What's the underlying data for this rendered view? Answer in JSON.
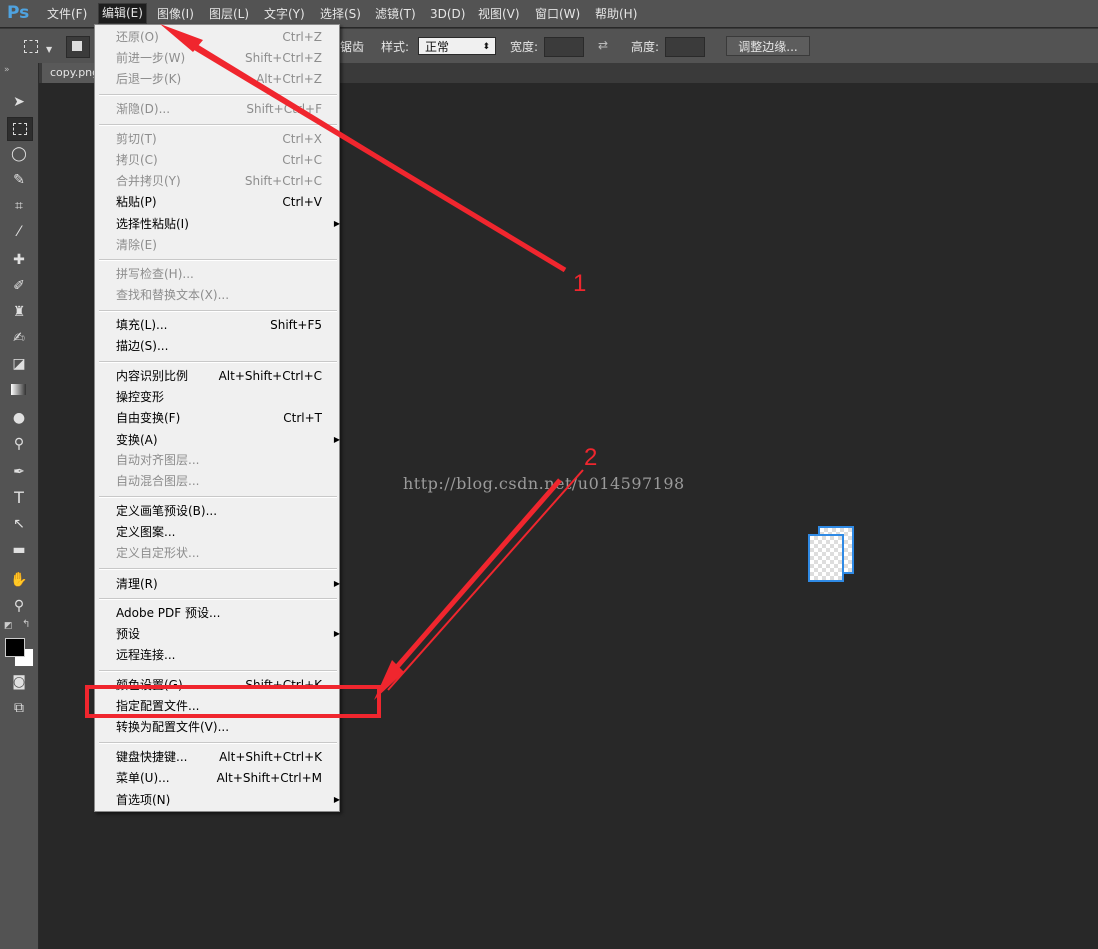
{
  "app_logo": "Ps",
  "menubar": [
    {
      "label": "文件(F)"
    },
    {
      "label": "编辑(E)",
      "active": true
    },
    {
      "label": "图像(I)"
    },
    {
      "label": "图层(L)"
    },
    {
      "label": "文字(Y)"
    },
    {
      "label": "选择(S)"
    },
    {
      "label": "滤镜(T)"
    },
    {
      "label": "3D(D)"
    },
    {
      "label": "视图(V)"
    },
    {
      "label": "窗口(W)"
    },
    {
      "label": "帮助(H)"
    }
  ],
  "options": {
    "partial_label": "锯齿",
    "style_label": "样式:",
    "style_value": "正常",
    "width_label": "宽度:",
    "height_label": "高度:",
    "refine_button": "调整边缘..."
  },
  "document_tab": "copy.png",
  "watermark": "http://blog.csdn.net/u014597198",
  "edit_menu": [
    {
      "label": "还原(O)",
      "shortcut": "Ctrl+Z",
      "disabled": true
    },
    {
      "label": "前进一步(W)",
      "shortcut": "Shift+Ctrl+Z",
      "disabled": true
    },
    {
      "label": "后退一步(K)",
      "shortcut": "Alt+Ctrl+Z",
      "disabled": true
    },
    {
      "sep": true
    },
    {
      "label": "渐隐(D)...",
      "shortcut": "Shift+Ctrl+F",
      "disabled": true
    },
    {
      "sep": true
    },
    {
      "label": "剪切(T)",
      "shortcut": "Ctrl+X",
      "disabled": true
    },
    {
      "label": "拷贝(C)",
      "shortcut": "Ctrl+C",
      "disabled": true
    },
    {
      "label": "合并拷贝(Y)",
      "shortcut": "Shift+Ctrl+C",
      "disabled": true
    },
    {
      "label": "粘贴(P)",
      "shortcut": "Ctrl+V",
      "disabled": false
    },
    {
      "label": "选择性粘贴(I)",
      "shortcut": "",
      "disabled": false,
      "submenu": true
    },
    {
      "label": "清除(E)",
      "shortcut": "",
      "disabled": true
    },
    {
      "sep": true
    },
    {
      "label": "拼写检查(H)...",
      "shortcut": "",
      "disabled": true
    },
    {
      "label": "查找和替换文本(X)...",
      "shortcut": "",
      "disabled": true
    },
    {
      "sep": true
    },
    {
      "label": "填充(L)...",
      "shortcut": "Shift+F5",
      "disabled": false
    },
    {
      "label": "描边(S)...",
      "shortcut": "",
      "disabled": false
    },
    {
      "sep": true
    },
    {
      "label": "内容识别比例",
      "shortcut": "Alt+Shift+Ctrl+C",
      "disabled": false
    },
    {
      "label": "操控变形",
      "shortcut": "",
      "disabled": false
    },
    {
      "label": "自由变换(F)",
      "shortcut": "Ctrl+T",
      "disabled": false
    },
    {
      "label": "变换(A)",
      "shortcut": "",
      "disabled": false,
      "submenu": true
    },
    {
      "label": "自动对齐图层...",
      "shortcut": "",
      "disabled": true
    },
    {
      "label": "自动混合图层...",
      "shortcut": "",
      "disabled": true
    },
    {
      "sep": true
    },
    {
      "label": "定义画笔预设(B)...",
      "shortcut": "",
      "disabled": false
    },
    {
      "label": "定义图案...",
      "shortcut": "",
      "disabled": false
    },
    {
      "label": "定义自定形状...",
      "shortcut": "",
      "disabled": true
    },
    {
      "sep": true
    },
    {
      "label": "清理(R)",
      "shortcut": "",
      "disabled": false,
      "submenu": true
    },
    {
      "sep": true
    },
    {
      "label": "Adobe PDF 预设...",
      "shortcut": "",
      "disabled": false
    },
    {
      "label": "预设",
      "shortcut": "",
      "disabled": false,
      "submenu": true
    },
    {
      "label": "远程连接...",
      "shortcut": "",
      "disabled": false
    },
    {
      "sep": true
    },
    {
      "label": "颜色设置(G)...",
      "shortcut": "Shift+Ctrl+K",
      "disabled": false
    },
    {
      "label": "指定配置文件...",
      "shortcut": "",
      "disabled": false
    },
    {
      "label": "转换为配置文件(V)...",
      "shortcut": "",
      "disabled": false
    },
    {
      "sep": true
    },
    {
      "label": "键盘快捷键...",
      "shortcut": "Alt+Shift+Ctrl+K",
      "disabled": false
    },
    {
      "label": "菜单(U)...",
      "shortcut": "Alt+Shift+Ctrl+M",
      "disabled": false
    },
    {
      "label": "首选项(N)",
      "shortcut": "",
      "disabled": false,
      "submenu": true
    }
  ],
  "annotations": {
    "marker_1": "1",
    "marker_2": "2",
    "color": "#f0262e"
  },
  "tools": [
    "move-tool",
    "marquee-tool",
    "lasso-tool",
    "quick-select-tool",
    "crop-tool",
    "eyedropper-tool",
    "healing-brush-tool",
    "brush-tool",
    "clone-stamp-tool",
    "history-brush-tool",
    "eraser-tool",
    "gradient-tool",
    "blur-tool",
    "dodge-tool",
    "pen-tool",
    "type-tool",
    "path-select-tool",
    "shape-tool",
    "hand-tool",
    "zoom-tool"
  ]
}
